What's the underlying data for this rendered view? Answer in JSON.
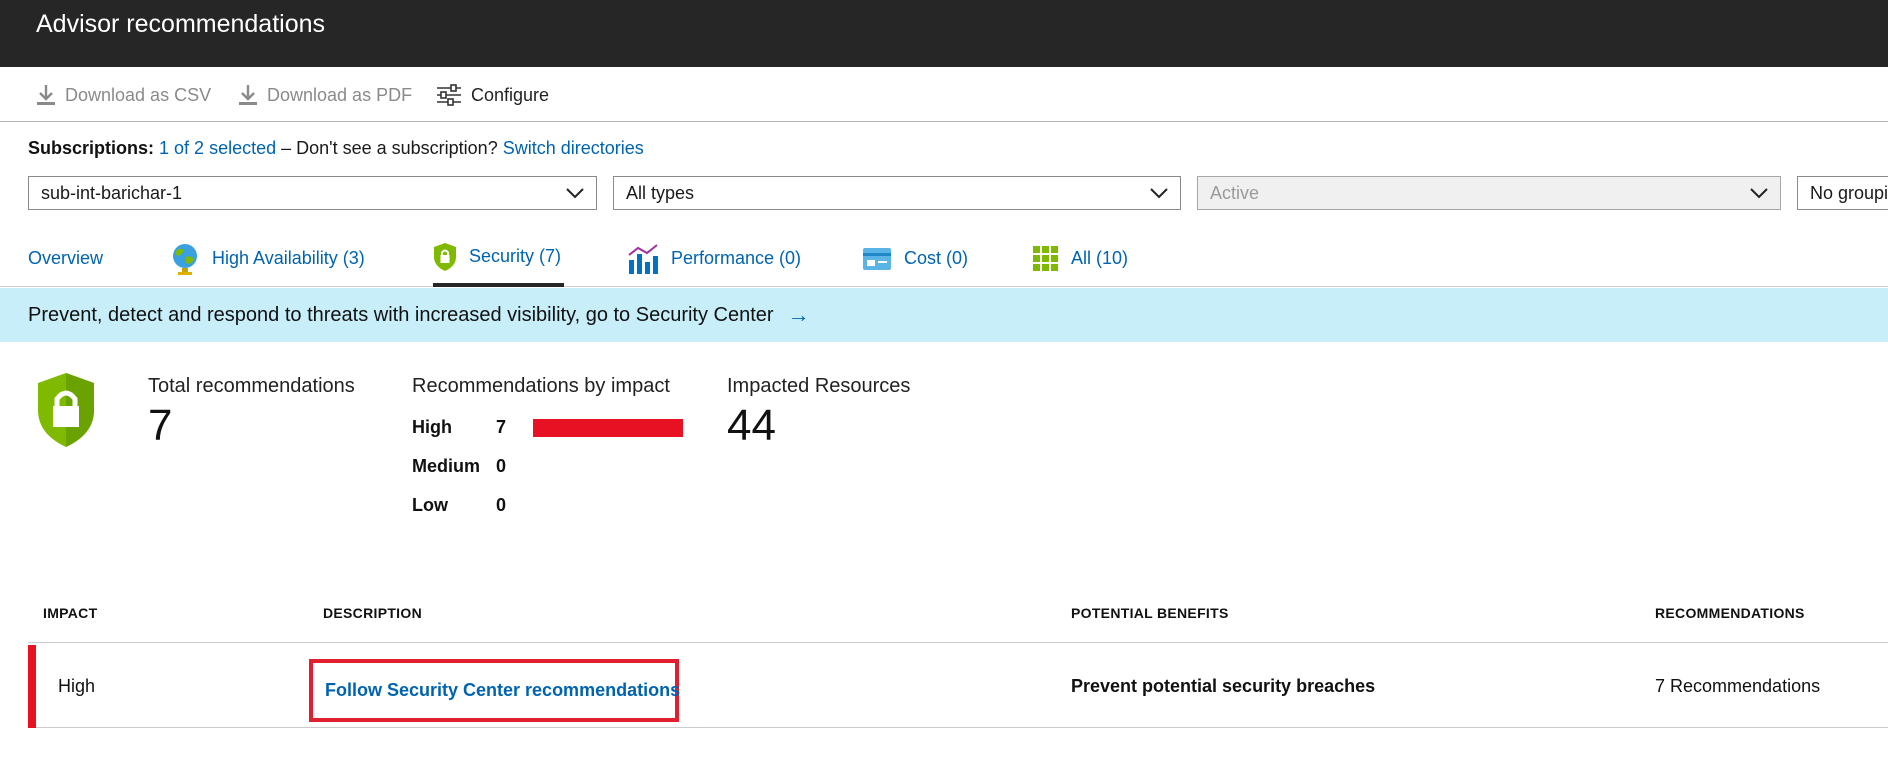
{
  "window": {
    "title": "Advisor recommendations"
  },
  "toolbar": {
    "download_csv": "Download as CSV",
    "download_pdf": "Download as PDF",
    "configure": "Configure"
  },
  "subscriptions": {
    "label": "Subscriptions:",
    "selected_link": "1 of 2 selected",
    "prompt": "– Don't see a subscription?",
    "switch_link": "Switch directories"
  },
  "filters": {
    "subscription": "sub-int-barichar-1",
    "types": "All types",
    "status": "Active",
    "grouping": "No grouping"
  },
  "tabs": [
    {
      "label": "Overview",
      "icon": "none"
    },
    {
      "label": "High Availability (3)",
      "icon": "globe-icon"
    },
    {
      "label": "Security (7)",
      "icon": "shield-icon"
    },
    {
      "label": "Performance (0)",
      "icon": "chart-icon"
    },
    {
      "label": "Cost (0)",
      "icon": "card-icon"
    },
    {
      "label": "All (10)",
      "icon": "grid-icon"
    }
  ],
  "active_tab": "Security (7)",
  "banner": {
    "text": "Prevent, detect and respond to threats with increased visibility, go to Security Center",
    "arrow": "→"
  },
  "summary": {
    "total_label": "Total recommendations",
    "total_value": "7",
    "impact_label": "Recommendations by impact",
    "impacts": [
      {
        "level": "High",
        "count": "7",
        "fraction": 1.0
      },
      {
        "level": "Medium",
        "count": "0",
        "fraction": 0
      },
      {
        "level": "Low",
        "count": "0",
        "fraction": 0
      }
    ],
    "resources_label": "Impacted Resources",
    "resources_value": "44"
  },
  "table": {
    "headers": [
      "IMPACT",
      "DESCRIPTION",
      "POTENTIAL BENEFITS",
      "RECOMMENDATIONS"
    ],
    "rows": [
      {
        "impact": "High",
        "description": "Follow Security Center recommendations",
        "benefits": "Prevent potential security breaches",
        "recommendations": "7 Recommendations"
      }
    ]
  },
  "colors": {
    "titlebar": "#262626",
    "link": "#0063b1",
    "banner": "#c7eef9",
    "high_impact": "#e81123",
    "shield_green": "#7fba00",
    "highlight_box": "#e0202e"
  }
}
